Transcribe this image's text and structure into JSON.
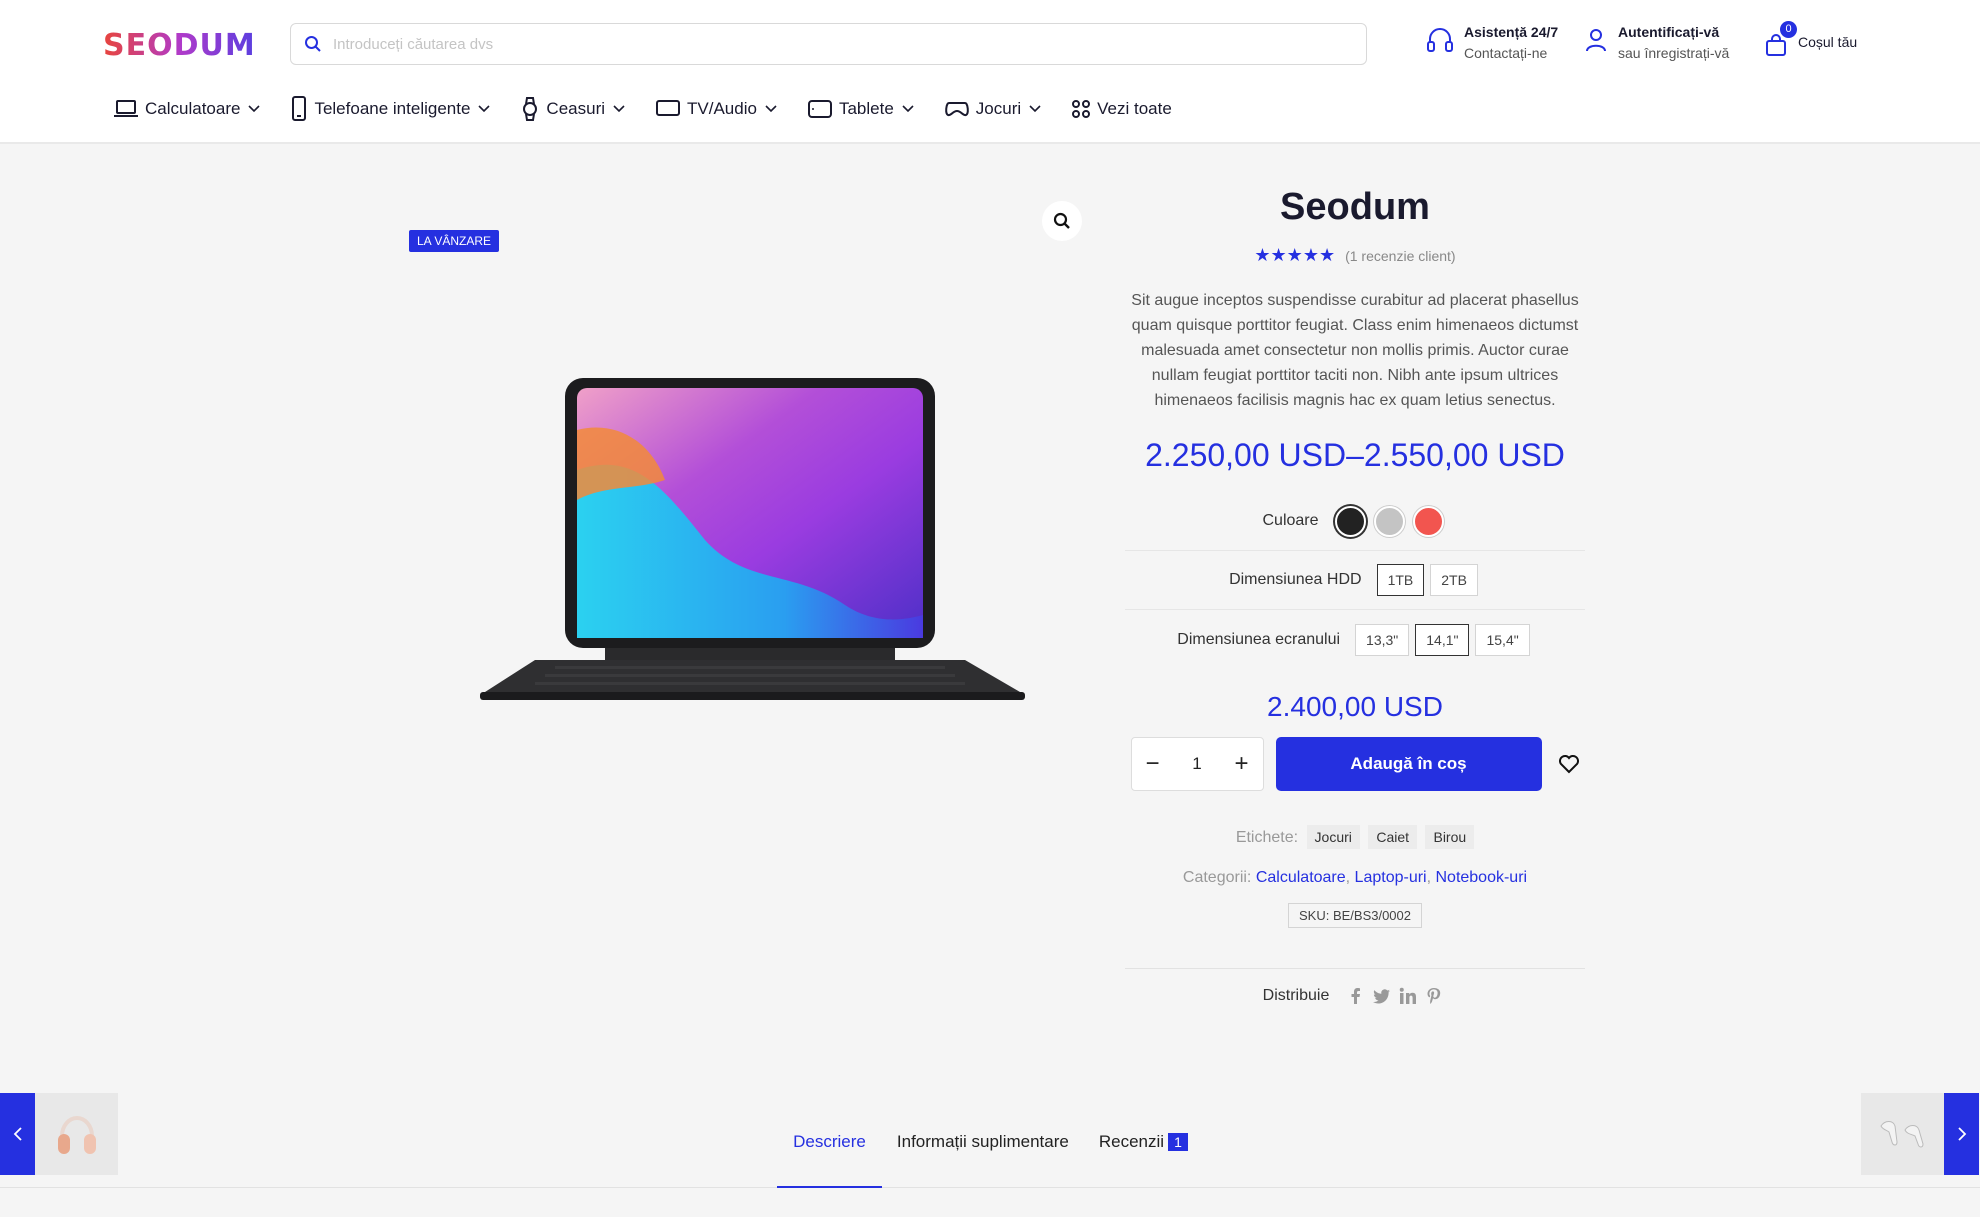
{
  "header": {
    "logo": "SEODUM",
    "search_placeholder": "Introduceți căutarea dvs",
    "support_title": "Asistență 24/7",
    "support_sub": "Contactați-ne",
    "account_title": "Autentificați-vă",
    "account_sub": "sau înregistrați-vă",
    "cart_count": "0",
    "cart_label": "Coșul tău"
  },
  "nav": {
    "items": [
      {
        "label": "Calculatoare",
        "icon": "laptop-icon"
      },
      {
        "label": "Telefoane inteligente",
        "icon": "phone-icon"
      },
      {
        "label": "Ceasuri",
        "icon": "watch-icon"
      },
      {
        "label": "TV/Audio",
        "icon": "tv-icon"
      },
      {
        "label": "Tablete",
        "icon": "tablet-icon"
      },
      {
        "label": "Jocuri",
        "icon": "gamepad-icon"
      },
      {
        "label": "Vezi toate",
        "icon": "grid-icon"
      }
    ]
  },
  "product": {
    "sale_badge": "LA VÂNZARE",
    "title": "Seodum",
    "stars": "★★★★★",
    "rating_count": 5,
    "reviews_text": "(1 recenzie client)",
    "description": "Sit augue inceptos suspendisse curabitur ad placerat phasellus quam quisque porttitor feugiat. Class enim himenaeos dictumst malesuada amet consectetur non mollis primis. Auctor curae nullam feugiat porttitor taciti non. Nibh ante ipsum ultrices himenaeos facilisis magnis hac ex quam letius senectus.",
    "price_range": "2.250,00 USD–2.550,00 USD",
    "color_label": "Culoare",
    "colors": [
      "#222222",
      "#c4c4c4",
      "#f2554f"
    ],
    "hdd_label": "Dimensiunea HDD",
    "hdd_options": [
      "1TB",
      "2TB"
    ],
    "screen_label": "Dimensiunea ecranului",
    "screen_options": [
      "13,3\"",
      "14,1\"",
      "15,4\""
    ],
    "selected_price": "2.400,00 USD",
    "quantity": "1",
    "minus": "−",
    "plus": "+",
    "add_to_cart": "Adaugă în coș",
    "tags_label": "Etichete:",
    "tags": [
      "Jocuri",
      "Caiet",
      "Birou"
    ],
    "categories_label": "Categorii:",
    "categories": [
      "Calculatoare",
      "Laptop-uri",
      "Notebook-uri"
    ],
    "sku": "SKU:  BE/BS3/0002",
    "share_label": "Distribuie"
  },
  "tabs": {
    "description": "Descriere",
    "additional": "Informații suplimentare",
    "reviews": "Recenzii",
    "reviews_count": "1"
  },
  "accent_color": "#2530e0"
}
